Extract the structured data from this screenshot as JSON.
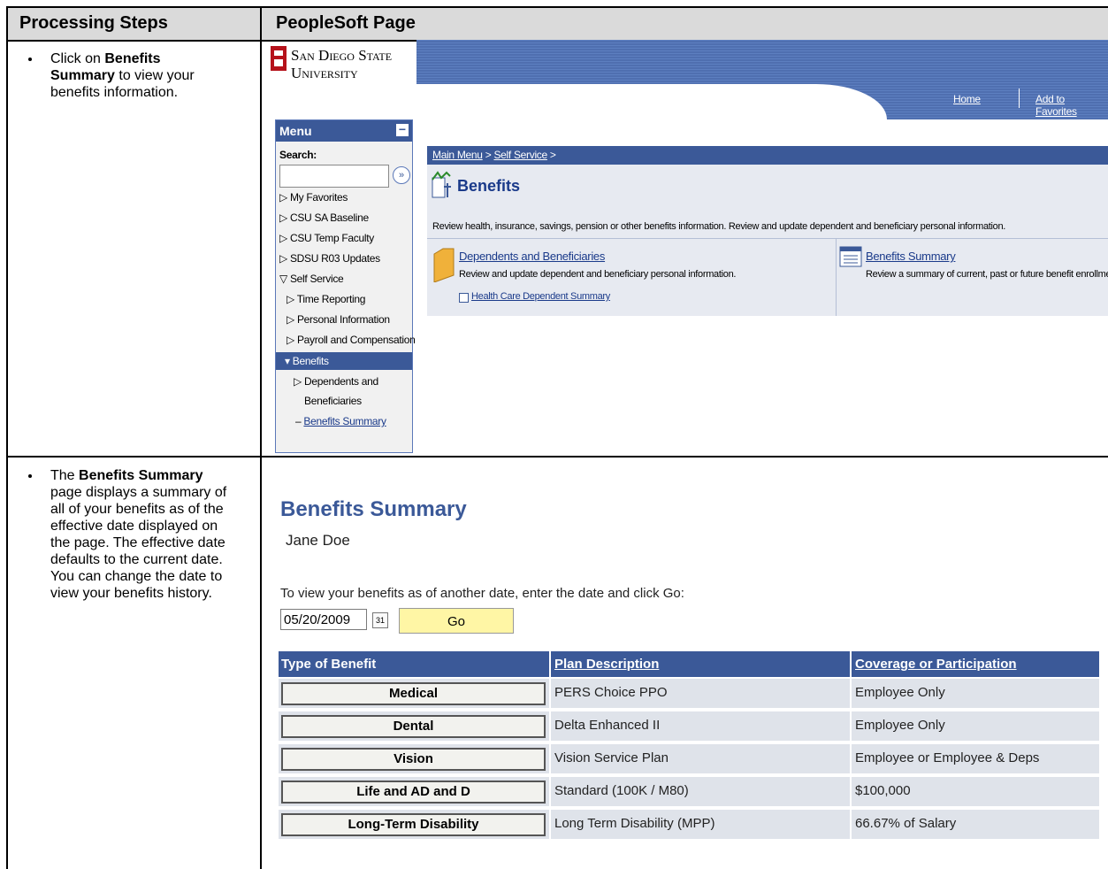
{
  "header": {
    "col1": "Processing Steps",
    "col2": "PeopleSoft Page"
  },
  "step1": {
    "pre": "Click on ",
    "bold": "Benefits Summary",
    "post": " to view your benefits information."
  },
  "step2": {
    "pre": "The ",
    "bold": "Benefits Summary",
    "post": " page displays a summary of all of your benefits as of the effective date displayed on the page. The effective date defaults to the current date. You can change the date to view your benefits history."
  },
  "portal": {
    "logo_line1": "San Diego State",
    "logo_line2": "University",
    "nav_home": "Home",
    "nav_favorites": "Add to Favorites",
    "menu": {
      "title": "Menu",
      "search_label": "Search:",
      "items": [
        "My Favorites",
        "CSU SA Baseline",
        "CSU Temp Faculty",
        "SDSU R03 Updates",
        "Self Service",
        "Time Reporting",
        "Personal Information",
        "Payroll and Compensation",
        "Benefits",
        "Dependents and",
        "Beneficiaries",
        "Benefits Summary"
      ]
    },
    "breadcrumb_main": "Main Menu",
    "breadcrumb_sep": " > ",
    "breadcrumb_self": "Self Service",
    "breadcrumb_tail": " >",
    "page_title": "Benefits",
    "page_desc": "Review health, insurance, savings, pension or other benefits information. Review and update dependent and beneficiary personal information.",
    "dep_link": "Dependents and Beneficiaries",
    "dep_desc": "Review and update dependent and beneficiary personal information.",
    "hc_link": "Health Care Dependent Summary",
    "sum_link": "Benefits Summary",
    "sum_desc": "Review a summary of current, past or future benefit enrollments."
  },
  "summary": {
    "title": "Benefits Summary",
    "name": "Jane Doe",
    "instruction": "To view your benefits as of another date, enter the date and click Go:",
    "date": "05/20/2009",
    "calendar_label": "31",
    "go": "Go",
    "columns": [
      "Type of Benefit",
      "Plan Description",
      "Coverage or Participation"
    ],
    "rows": [
      {
        "type": "Medical",
        "plan": "PERS Choice PPO",
        "coverage": "Employee Only"
      },
      {
        "type": "Dental",
        "plan": "Delta Enhanced II",
        "coverage": "Employee Only"
      },
      {
        "type": "Vision",
        "plan": "Vision Service Plan",
        "coverage": "Employee or Employee & Deps"
      },
      {
        "type": "Life and AD and D",
        "plan": "Standard (100K / M80)",
        "coverage": "$100,000"
      },
      {
        "type": "Long-Term Disability",
        "plan": "Long Term Disability (MPP)",
        "coverage": "66.67% of Salary"
      }
    ]
  },
  "colors": {
    "header_bg": "#dadada",
    "ps_blue": "#3b5998",
    "go_yellow": "#fff6a5"
  }
}
